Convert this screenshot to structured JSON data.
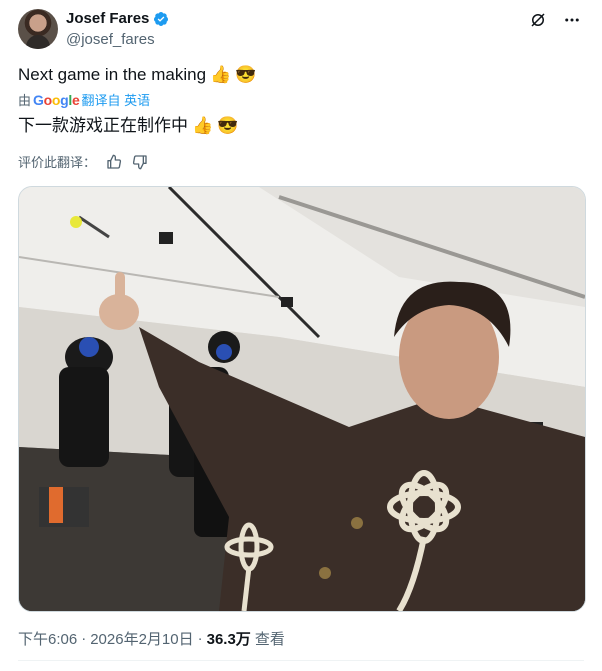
{
  "author": {
    "display_name": "Josef Fares",
    "handle": "@josef_fares"
  },
  "tweet": {
    "text": "Next game in the making",
    "translate_prefix": "由",
    "translate_brand": "Google",
    "translate_link": "翻译自 英语",
    "translated_text": "下一款游戏正在制作中",
    "rate_label": "评价此翻译：",
    "emoji_1": "👍",
    "emoji_2": "😎"
  },
  "meta": {
    "time": "下午6:06",
    "separator_1": "·",
    "date": "2026年2月10日",
    "separator_2": "·",
    "views_count": "36.3万",
    "views_label": "查看"
  },
  "icons": {
    "verified": "verified-badge-icon",
    "grok": "grok-icon",
    "more": "more-icon",
    "thumbs_up": "thumbs-up-icon",
    "thumbs_down": "thumbs-down-icon"
  },
  "colors": {
    "accent": "#1d9bf0",
    "secondary_text": "#536471",
    "primary_text": "#0f1419"
  }
}
